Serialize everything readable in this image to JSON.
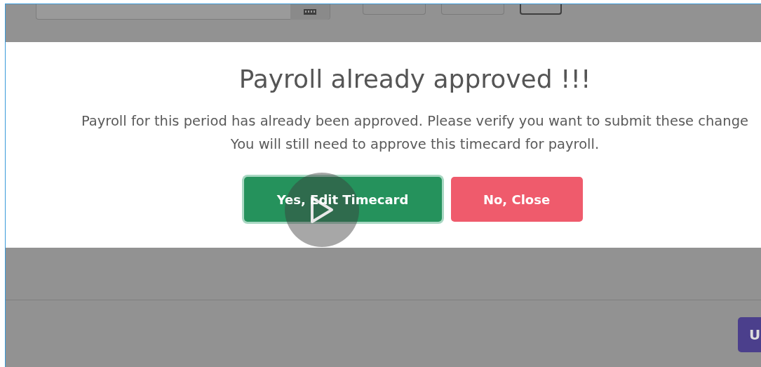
{
  "background_form": {
    "date_field": {
      "has_calendar_button": true
    },
    "buttons": [
      {
        "kind": "outline"
      },
      {
        "kind": "outline"
      },
      {
        "kind": "dark-outline"
      }
    ]
  },
  "dialog": {
    "title": "Payroll already approved !!!",
    "message_lines": [
      "Payroll for this period has already been approved. Please verify you want to submit these change",
      "You will still need to approve this timecard for payroll."
    ],
    "buttons": [
      {
        "label": "Yes, Edit Timecard",
        "kind": "confirm"
      },
      {
        "label": "No, Close",
        "kind": "cancel"
      }
    ]
  },
  "video_overlay": {
    "play_button": true
  },
  "footer_button": {
    "label": "U"
  }
}
